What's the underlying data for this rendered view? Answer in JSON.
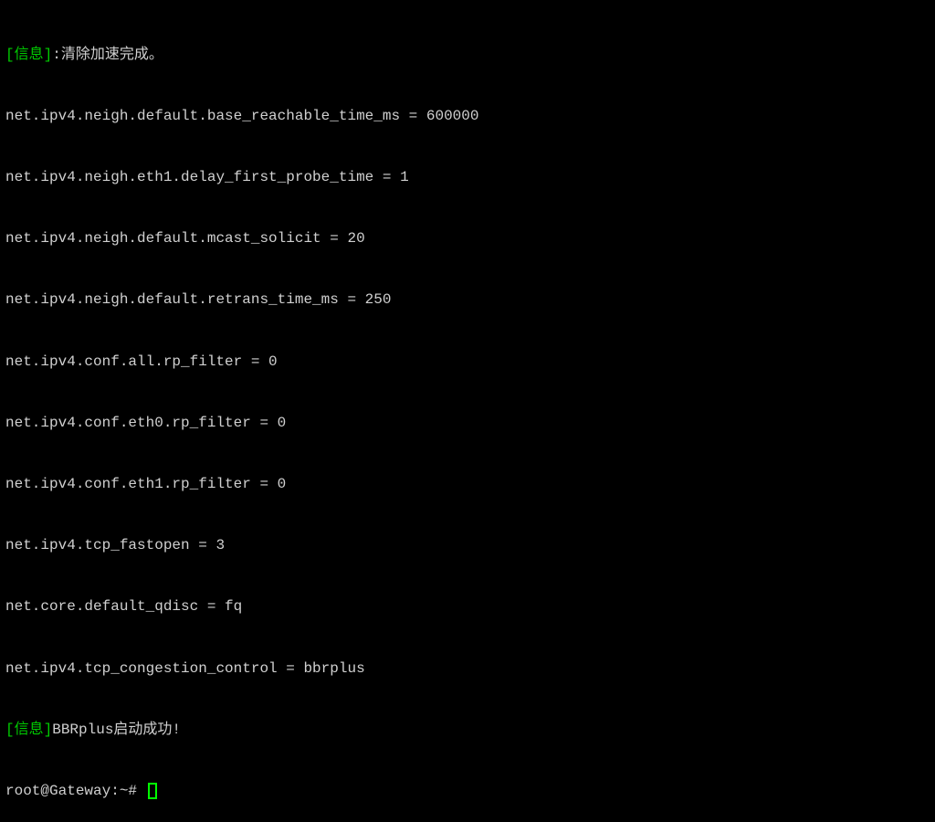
{
  "terminal": {
    "info_tag1": "[信息]",
    "info_msg1": ":清除加速完成。",
    "sysctl_lines": [
      "net.ipv4.neigh.default.base_reachable_time_ms = 600000",
      "net.ipv4.neigh.eth1.delay_first_probe_time = 1",
      "net.ipv4.neigh.default.mcast_solicit = 20",
      "net.ipv4.neigh.default.retrans_time_ms = 250",
      "net.ipv4.conf.all.rp_filter = 0",
      "net.ipv4.conf.eth0.rp_filter = 0",
      "net.ipv4.conf.eth1.rp_filter = 0",
      "net.ipv4.tcp_fastopen = 3",
      "net.core.default_qdisc = fq",
      "net.ipv4.tcp_congestion_control = bbrplus"
    ],
    "info_tag2": "[信息]",
    "info_msg2": "BBRplus启动成功!",
    "prompt": "root@Gateway:~# "
  }
}
